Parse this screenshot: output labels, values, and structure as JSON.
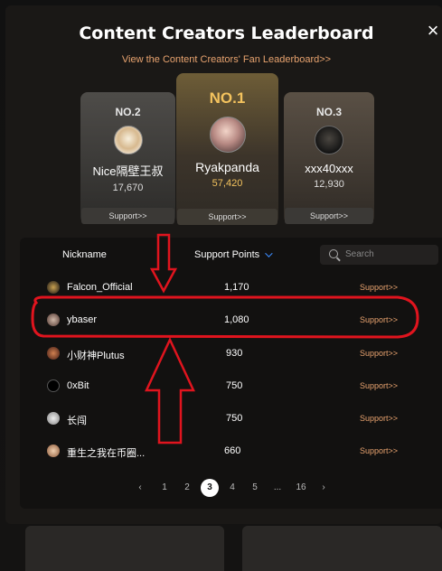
{
  "modal": {
    "title": "Content Creators Leaderboard",
    "fan_link": "View the Content Creators' Fan Leaderboard>>",
    "close": "×"
  },
  "podium": [
    {
      "rank": "NO.2",
      "name": "Nice隔壁王叔",
      "score": "17,670",
      "support": "Support>>"
    },
    {
      "rank": "NO.1",
      "name": "Ryakpanda",
      "score": "57,420",
      "support": "Support>>"
    },
    {
      "rank": "NO.3",
      "name": "xxx40xxx",
      "score": "12,930",
      "support": "Support>>"
    }
  ],
  "table": {
    "headers": {
      "nickname": "Nickname",
      "points": "Support Points"
    },
    "search_placeholder": "Search",
    "rows": [
      {
        "name": "Falcon_Official",
        "points": "1,170",
        "support": "Support>>"
      },
      {
        "name": "ybaser",
        "points": "1,080",
        "support": "Support>>"
      },
      {
        "name": "小财神Plutus",
        "points": "930",
        "support": "Support>>"
      },
      {
        "name": "0xBit",
        "points": "750",
        "support": "Support>>"
      },
      {
        "name": "长闯",
        "points": "750",
        "support": "Support>>"
      },
      {
        "name": "重生之我在币圈...",
        "points": "660",
        "support": "Support>>"
      }
    ]
  },
  "pagination": {
    "prev": "‹",
    "pages": [
      "1",
      "2",
      "3",
      "4",
      "5",
      "...",
      "16"
    ],
    "current": "3",
    "next": "›"
  },
  "colors": {
    "accent": "#e8a36f",
    "gold": "#f4c35e",
    "annotation": "#e0141e",
    "sort": "#3c8cff"
  }
}
